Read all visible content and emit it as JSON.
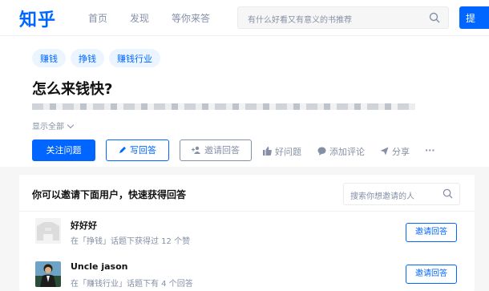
{
  "nav": {
    "logo": "知乎",
    "items": [
      "首页",
      "发现",
      "等你来答"
    ],
    "search_placeholder": "有什么好看又有意义的书推荐",
    "ask_label": "提"
  },
  "question": {
    "tags": [
      "赚钱",
      "挣钱",
      "赚钱行业"
    ],
    "title": "怎么来钱快?",
    "show_all": "显示全部",
    "follow_label": "关注问题",
    "write_label": "写回答",
    "invite_label": "邀请回答",
    "good_label": "好问题",
    "comment_label": "添加评论",
    "share_label": "分享",
    "more_label": "···"
  },
  "invite": {
    "title": "你可以邀请下面用户，快速获得回答",
    "search_placeholder": "搜索你想邀请的人",
    "users": [
      {
        "name": "好好好",
        "desc": "在「挣钱」话题下获得过 12 个赞",
        "button": "邀请回答"
      },
      {
        "name": "Uncle jason",
        "desc": "在「赚钱行业」话题下有 4 个回答",
        "button": "邀请回答"
      }
    ]
  }
}
